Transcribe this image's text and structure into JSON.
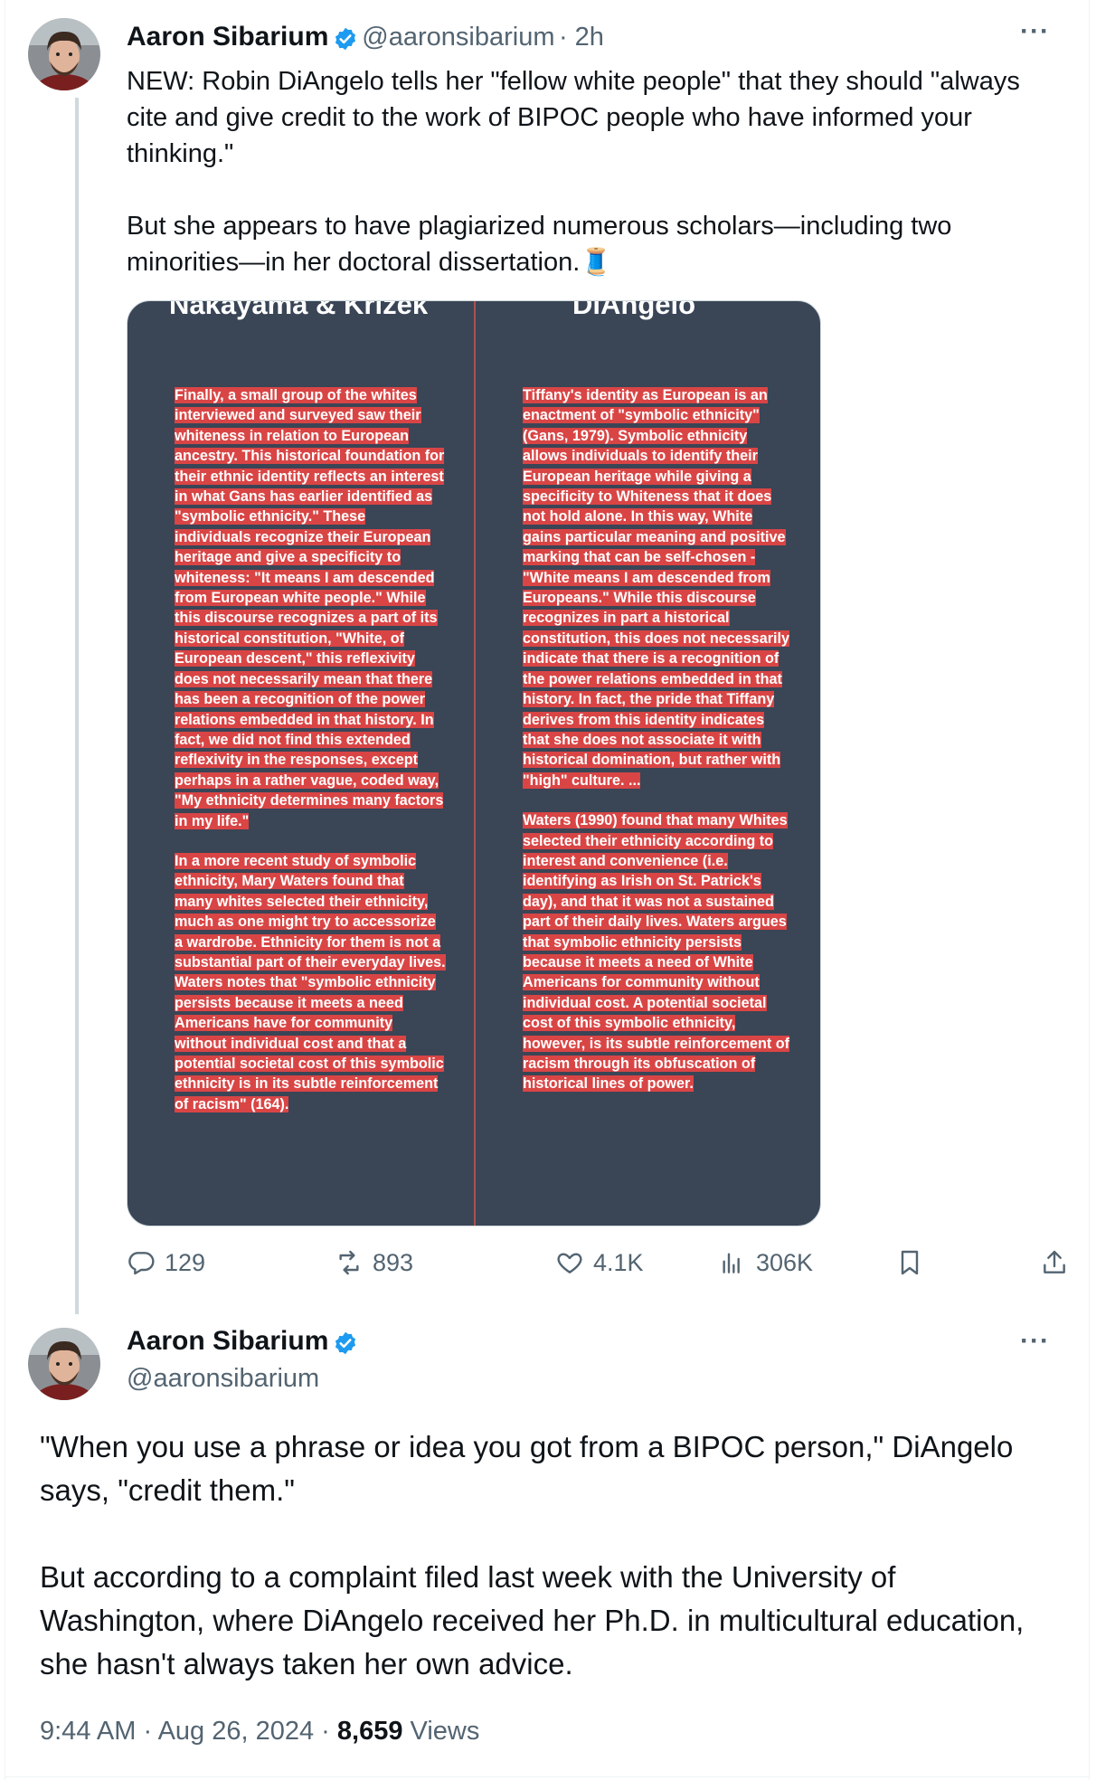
{
  "tweet1": {
    "author_name": "Aaron Sibarium",
    "handle": "@aaronsibarium",
    "time": "· 2h",
    "more_icon": "more-horizontal-icon",
    "paragraph1": "NEW: Robin DiAngelo tells her \"fellow white people\" that they should \"always cite and give credit to the work of BIPOC people who have informed your thinking.\"",
    "paragraph2": "But she appears to have plagiarized numerous scholars—including two minorities—in her doctoral dissertation.",
    "emoji": "🧵",
    "image": {
      "left_heading": "Nakayama & Krizek",
      "right_heading": "DiAngelo",
      "left_p1": "Finally, a small group of the whites interviewed and surveyed saw their whiteness in relation to European ancestry. This historical foundation for their ethnic identity reflects an interest in what Gans has earlier identified as \"symbolic ethnicity.\" These individuals recognize their European heritage and give a specificity to whiteness: \"It means I am descended from European white people.\" While this discourse recognizes a part of its historical constitution, \"White, of European descent,\" this reflexivity does not necessarily mean that there has been a recognition of the power relations embedded in that history. In fact, we did not find this extended reflexivity in the responses, except perhaps in a rather vague, coded way, \"My ethnicity determines many factors in my life.\"",
      "left_p2": "In a more recent study of symbolic ethnicity, Mary Waters found that many whites selected their ethnicity, much as one might try to accessorize a wardrobe. Ethnicity for them is not a substantial part of their everyday lives. Waters notes that \"symbolic ethnicity persists because it meets a need Americans have for community without individual cost and that a potential societal cost of this symbolic ethnicity is in its subtle reinforcement of racism\" (164).",
      "right_p1": "Tiffany's identity as European is an enactment of \"symbolic ethnicity\" (Gans, 1979). Symbolic ethnicity allows individuals to identify their European heritage while giving a specificity to Whiteness that it does not hold alone. In this way, White gains particular meaning and positive marking that can be self-chosen - \"White means I am descended from Europeans.\" While this discourse recognizes in part a historical constitution, this does not necessarily indicate that there is a recognition of the power relations embedded in that history. In fact, the pride that Tiffany derives from this identity indicates that she does not associate it with historical domination, but rather with \"high\" culture. ...",
      "right_p2": "Waters (1990) found that many Whites selected their ethnicity according to interest and convenience (i.e. identifying as Irish on St. Patrick's day), and that it was not a sustained part of their daily lives. Waters argues that symbolic ethnicity persists because it meets a need of White Americans for community without individual cost. A potential societal cost of this symbolic ethnicity, however, is its subtle reinforcement of racism through its obfuscation of historical lines of power."
    },
    "actions": {
      "replies": "129",
      "reposts": "893",
      "likes": "4.1K",
      "views": "306K"
    }
  },
  "tweet2": {
    "author_name": "Aaron Sibarium",
    "handle": "@aaronsibarium",
    "paragraph1": "\"When you use a phrase or idea you got from a BIPOC person,\" DiAngelo says, \"credit them.\"",
    "paragraph2": "But according to a complaint filed last week with the University of Washington, where DiAngelo received her Ph.D. in multicultural education, she hasn't always taken her own advice.",
    "timestamp": "9:44 AM · Aug 26, 2024 · ",
    "views_count": "8,659",
    "views_label": " Views"
  },
  "colors": {
    "verified": "#1d9bf0",
    "muted": "#536471",
    "image_bg": "#3a4556",
    "highlight": "#d94545"
  }
}
